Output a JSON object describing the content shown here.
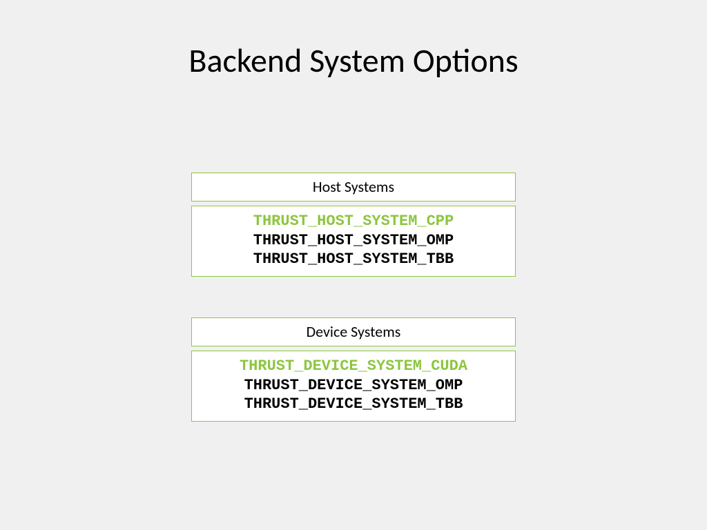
{
  "title": "Backend System Options",
  "host": {
    "header": "Host Systems",
    "options": [
      {
        "text": "THRUST_HOST_SYSTEM_CPP",
        "highlight": true
      },
      {
        "text": "THRUST_HOST_SYSTEM_OMP",
        "highlight": false
      },
      {
        "text": "THRUST_HOST_SYSTEM_TBB",
        "highlight": false
      }
    ]
  },
  "device": {
    "header": "Device Systems",
    "options": [
      {
        "text": "THRUST_DEVICE_SYSTEM_CUDA",
        "highlight": true
      },
      {
        "text": "THRUST_DEVICE_SYSTEM_OMP",
        "highlight": false
      },
      {
        "text": "THRUST_DEVICE_SYSTEM_TBB",
        "highlight": false
      }
    ]
  }
}
